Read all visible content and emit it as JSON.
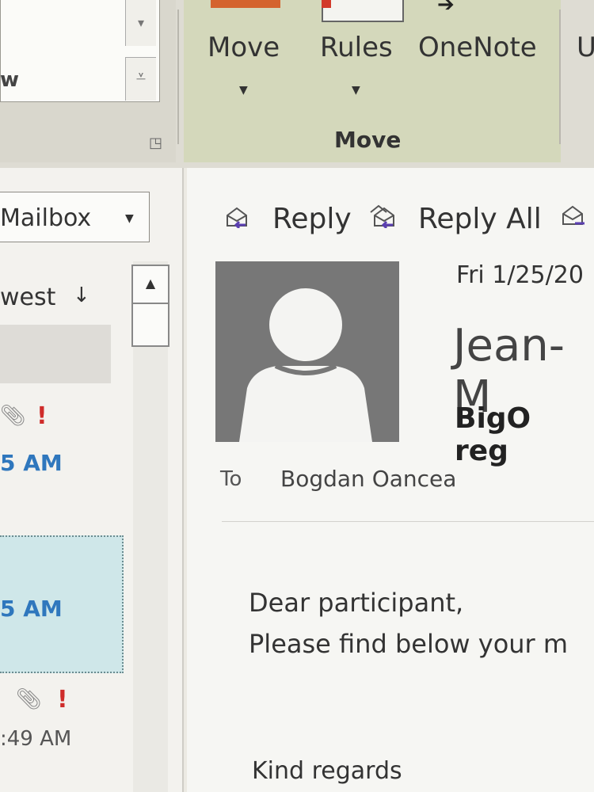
{
  "ribbon": {
    "quick_steps": {
      "visible_text": "w"
    },
    "move_group": {
      "buttons": [
        {
          "label": "Move",
          "icon": "move-icon"
        },
        {
          "label": "Rules",
          "icon": "rules-icon"
        },
        {
          "label": "OneNote",
          "icon": "onenote-icon"
        }
      ],
      "group_label": "Move"
    },
    "partial_next_button": "U"
  },
  "folder_pane": {
    "mailbox_dropdown": "Mailbox",
    "sort_label": "west",
    "items": [
      {
        "time": "5 AM",
        "has_attachment": true,
        "high_importance": true,
        "importance_glyph": "!"
      },
      {
        "time": "5 AM",
        "selected": true
      },
      {
        "time": ":49 AM",
        "has_attachment": true,
        "high_importance": true,
        "importance_glyph": "!"
      }
    ]
  },
  "reading_pane": {
    "actions": [
      {
        "label": "Reply",
        "icon": "reply-icon"
      },
      {
        "label": "Reply All",
        "icon": "reply-all-icon"
      },
      {
        "label": "",
        "icon": "forward-icon"
      }
    ],
    "date": "Fri 1/25/20",
    "sender": "Jean-M",
    "subject": "BigO reg",
    "to_label": "To",
    "to": "Bogdan Oancea",
    "body": {
      "greeting": "Dear participant,",
      "line_2": "Please find below your m",
      "closing": "Kind regards"
    }
  },
  "colors": {
    "ribbon_bg": "#dedcd3",
    "move_group_bg": "#d4d8bb",
    "selection_bg": "#cfe7e9",
    "time_blue": "#2f77bd",
    "importance_red": "#cf2c2a",
    "avatar_gray": "#777777"
  }
}
